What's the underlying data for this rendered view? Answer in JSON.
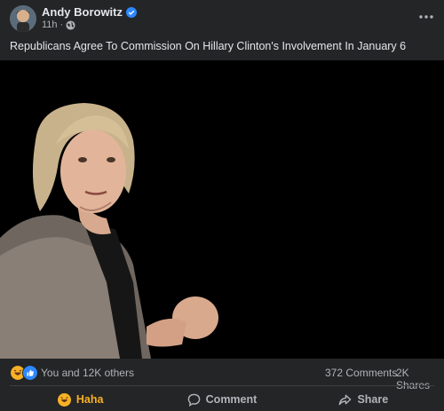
{
  "post": {
    "author": "Andy Borowitz",
    "timestamp": "11h",
    "separator": "·",
    "caption": "Republicans Agree To Commission On Hillary Clinton's Involvement In January 6",
    "verified_icon": "verified-badge-icon",
    "privacy_icon": "globe-icon",
    "more_icon": "more-options-icon"
  },
  "reactions": {
    "icons": [
      "haha-reaction-icon",
      "like-reaction-icon"
    ],
    "summary": "You and 12K others",
    "comments": "372 Comments",
    "shares": "2K Shares"
  },
  "actions": {
    "react_label": "Haha",
    "comment_label": "Comment",
    "share_label": "Share"
  },
  "colors": {
    "background": "#242526",
    "text_primary": "#e4e6eb",
    "text_secondary": "#b0b3b8",
    "verified_blue": "#2d88ff",
    "haha_yellow": "#f7b125",
    "photo_background": "#000000"
  }
}
